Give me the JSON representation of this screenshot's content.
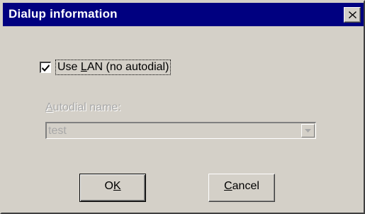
{
  "window": {
    "title": "Dialup information"
  },
  "icons": {
    "close": "close-icon",
    "checkmark": "checkmark-icon",
    "dropdown": "chevron-down-icon"
  },
  "use_lan": {
    "label_prefix": "Use ",
    "label_underlined": "L",
    "label_suffix": "AN (no autodial)",
    "checked": true
  },
  "autodial": {
    "label_underlined": "A",
    "label_suffix": "utodial name:",
    "value": "test",
    "enabled": false
  },
  "buttons": {
    "ok_prefix": "O",
    "ok_underlined": "K",
    "cancel_underlined": "C",
    "cancel_suffix": "ancel"
  },
  "colors": {
    "titlebar": "#000080",
    "face": "#d4d0c8",
    "disabled_text": "#a8a8a8"
  }
}
